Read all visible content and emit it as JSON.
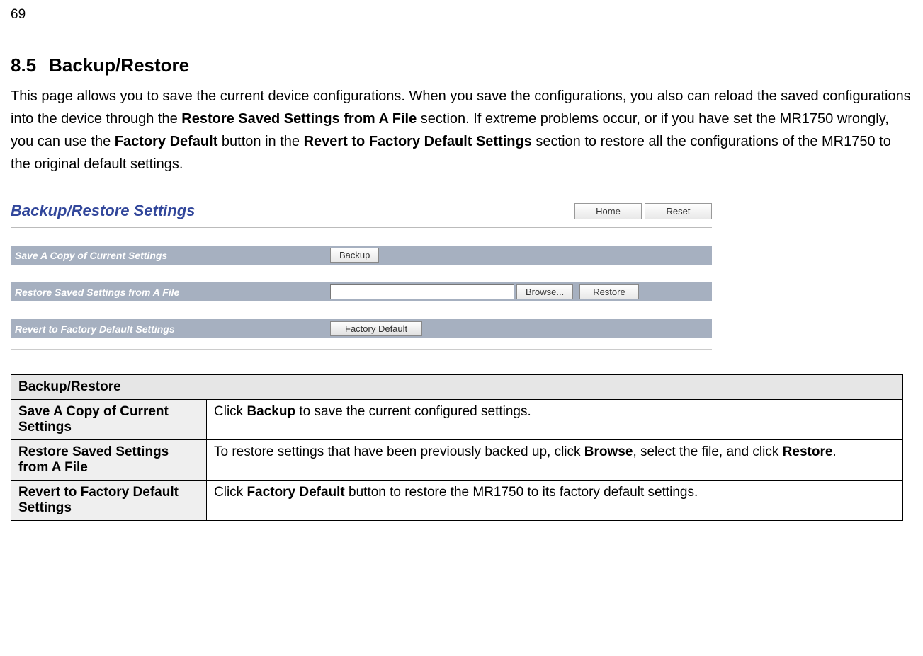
{
  "page_number": "69",
  "heading_number": "8.5",
  "heading_title": "Backup/Restore",
  "intro": {
    "p1a": "This page allows you to save the current device configurations. When you save the configurations, you also can reload the saved configurations into the device through the ",
    "p1b_bold": "Restore Saved Settings from A File",
    "p1c": " section. If extreme problems occur, or if you have set the MR1750 wrongly, you can use the ",
    "p1d_bold": "Factory Default",
    "p1e": " button in the ",
    "p1f_bold": "Revert to Factory Default Settings",
    "p1g": " section to restore all the configurations of the MR1750 to the original default settings."
  },
  "ui": {
    "title": "Backup/Restore Settings",
    "home_btn": "Home",
    "reset_btn": "Reset",
    "row1_label": "Save A Copy of Current Settings",
    "row1_btn": "Backup",
    "row2_label": "Restore Saved Settings from A File",
    "row2_browse": "Browse...",
    "row2_restore": "Restore",
    "row3_label": "Revert to Factory Default Settings",
    "row3_btn": "Factory Default"
  },
  "table": {
    "header": "Backup/Restore",
    "rows": [
      {
        "left": "Save A Copy of Current Settings",
        "r1a": "Click ",
        "r1b_bold": "Backup",
        "r1c": " to save the current configured settings."
      },
      {
        "left": "Restore Saved Settings from A File",
        "r2a": "To restore settings that have been previously backed up, click ",
        "r2b_bold": "Browse",
        "r2c": ", select the file, and click ",
        "r2d_bold": "Restore",
        "r2e": "."
      },
      {
        "left": "Revert to Factory Default Settings",
        "r3a": "Click ",
        "r3b_bold": "Factory Default",
        "r3c": " button to restore the MR1750 to its factory default settings."
      }
    ]
  }
}
